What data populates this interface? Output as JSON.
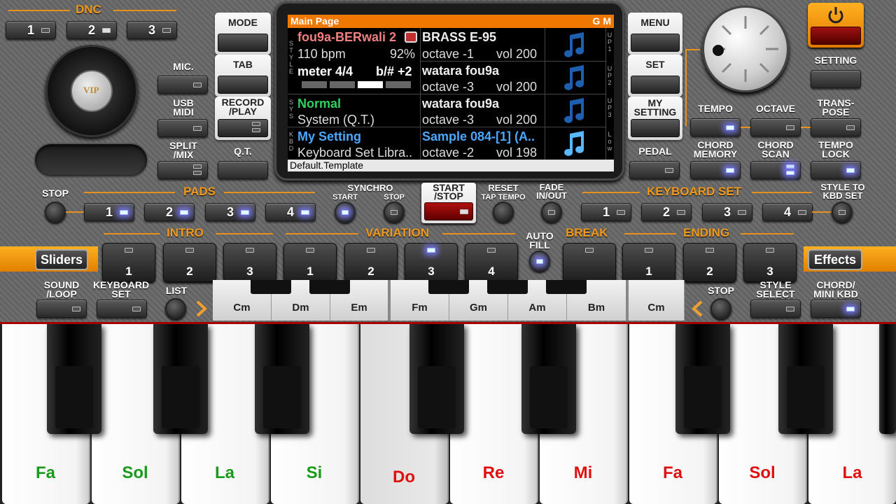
{
  "dnc": {
    "title": "DNC",
    "buttons": [
      "1",
      "2",
      "3"
    ]
  },
  "left": {
    "mic": "MIC.",
    "usb": "USB\nMIDI",
    "split": "SPLIT\n/MIX",
    "vip": "VIP"
  },
  "mid": {
    "mode": "MODE",
    "tab": "TAB",
    "record": "RECORD\n/PLAY",
    "qt": "Q.T."
  },
  "display": {
    "header": "Main Page",
    "header_right": "G M",
    "style_name": "fou9a-BERwali 2",
    "bpm": "110 bpm",
    "percent": "92%",
    "meter": "meter 4/4",
    "key": "b/# +2",
    "chord_mode": "Normal",
    "system": "System (Q.T.)",
    "kbd_name": "My Setting",
    "kbd_lib": "Keyboard Set Libra..",
    "up1_name": "BRASS E-95",
    "up1_oct": "octave -1",
    "up1_vol": "vol 200",
    "up2_name": "watara fou9a",
    "up2_oct": "octave -3",
    "up2_vol": "vol 200",
    "up3_name": "watara fou9a",
    "up3_oct": "octave -3",
    "up3_vol": "vol 200",
    "low_name": "Sample 084-[1] (A..",
    "low_oct": "octave -2",
    "low_vol": "vol 198",
    "footer": "Default.Template",
    "side_style": "STYLE",
    "side_sys": "SYS",
    "side_kbd": "KBD",
    "up1": "UP1",
    "up2": "UP2",
    "up3": "UP3",
    "low": "Low"
  },
  "right": {
    "menu": "MENU",
    "set": "SET",
    "my_setting": "MY\nSETTING",
    "pedal": "PEDAL",
    "setting": "SETTING",
    "tempo": "TEMPO",
    "octave": "OCTAVE",
    "transpose": "TRANS-\nPOSE",
    "chord_memory": "CHORD\nMEMORY",
    "chord_scan": "CHORD\nSCAN",
    "tempo_lock": "TEMPO\nLOCK"
  },
  "row2": {
    "stop": "STOP",
    "pads": "PADS",
    "pad_buttons": [
      "1",
      "2",
      "3",
      "4"
    ],
    "synchro": "SYNCHRO",
    "sync_start": "START",
    "sync_stop": "STOP",
    "start_stop": "START\n/STOP",
    "reset": "RESET",
    "tap_tempo": "TAP TEMPO",
    "fade": "FADE\nIN/OUT",
    "keyboard_set": "KEYBOARD SET",
    "kbd_buttons": [
      "1",
      "2",
      "3",
      "4"
    ],
    "style_to_kbd": "STYLE TO\nKBD SET"
  },
  "row3": {
    "intro": "INTRO",
    "variation": "VARIATION",
    "auto_fill": "AUTO\nFILL",
    "break": "BREAK",
    "ending": "ENDING",
    "sliders": "Sliders",
    "effects": "Effects",
    "intro_buttons": [
      "1",
      "2",
      "3"
    ],
    "var_buttons": [
      "1",
      "2",
      "3",
      "4"
    ],
    "ending_buttons": [
      "1",
      "2",
      "3"
    ]
  },
  "row4": {
    "sound_loop": "SOUND\n/LOOP",
    "keyboard_set": "KEYBOARD\nSET",
    "list": "LIST",
    "stop": "STOP",
    "style_select": "STYLE\nSELECT",
    "chord_mini": "CHORD/\nMINI KBD",
    "chords": [
      "Cm",
      "Dm",
      "Em",
      "Fm",
      "Gm",
      "Am",
      "Bm",
      "Cm"
    ]
  },
  "keys": [
    "Fa",
    "Sol",
    "La",
    "Si",
    "Do",
    "Re",
    "Mi",
    "Fa",
    "Sol",
    "La"
  ],
  "colors": {
    "accent": "#f07800",
    "green_note": "#1a9a1a",
    "red_note": "#e01010",
    "display_pink": "#f08080",
    "display_green": "#30d060",
    "display_blue": "#4aa8ff"
  }
}
